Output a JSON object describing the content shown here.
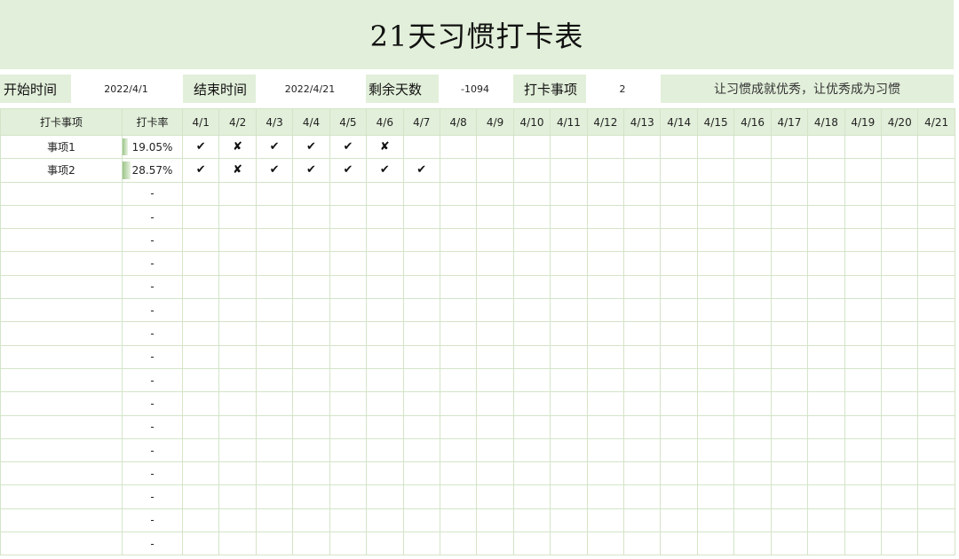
{
  "title": "21天习惯打卡表",
  "info": {
    "start_label": "开始时间",
    "start_value": "2022/4/1",
    "end_label": "结束时间",
    "end_value": "2022/4/21",
    "remaining_label": "剩余天数",
    "remaining_value": "-1094",
    "count_label": "打卡事项",
    "count_value": "2",
    "slogan": "让习惯成就优秀，让优秀成为习惯"
  },
  "table": {
    "header_item": "打卡事项",
    "header_rate": "打卡率",
    "days": [
      "4/1",
      "4/2",
      "4/3",
      "4/4",
      "4/5",
      "4/6",
      "4/7",
      "4/8",
      "4/9",
      "4/10",
      "4/11",
      "4/12",
      "4/13",
      "4/14",
      "4/15",
      "4/16",
      "4/17",
      "4/18",
      "4/19",
      "4/20",
      "4/21"
    ],
    "rows": [
      {
        "name": "事项1",
        "rate": "19.05%",
        "rate_value": 0.1905,
        "marks": [
          "✔",
          "✘",
          "✔",
          "✔",
          "✔",
          "✘",
          "",
          "",
          "",
          "",
          "",
          "",
          "",
          "",
          "",
          "",
          "",
          "",
          "",
          "",
          ""
        ]
      },
      {
        "name": "事项2",
        "rate": "28.57%",
        "rate_value": 0.2857,
        "marks": [
          "✔",
          "✘",
          "✔",
          "✔",
          "✔",
          "✔",
          "✔",
          "",
          "",
          "",
          "",
          "",
          "",
          "",
          "",
          "",
          "",
          "",
          "",
          "",
          ""
        ]
      }
    ],
    "empty_rows": 16,
    "empty_rate": "-"
  }
}
